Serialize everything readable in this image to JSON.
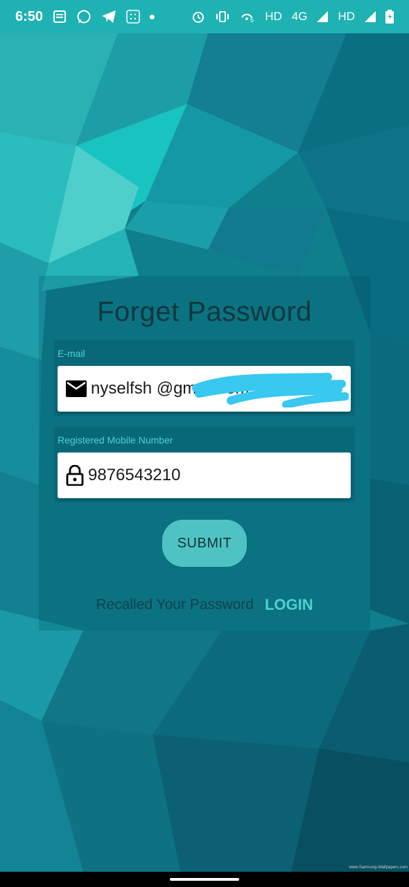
{
  "status_bar": {
    "time": "6:50",
    "network_text_1": "HD",
    "network_text_2": "4G",
    "network_text_3": "HD",
    "icons": [
      "news-icon",
      "whatsapp-icon",
      "telegram-icon",
      "grid-app-icon",
      "dot-icon",
      "alarm-icon",
      "vibrate-icon",
      "hotspot-icon",
      "signal-icon",
      "battery-icon"
    ]
  },
  "form": {
    "title": "Forget Password",
    "email_label": "E-mail",
    "email_value": "nyselfsh        @gmail.com",
    "mobile_label": "Registered Mobile Number",
    "mobile_value": "9876543210",
    "submit_label": "SUBMIT",
    "recall_text": "Recalled Your Password",
    "login_label": "LOGIN"
  },
  "watermark": "www.Samsung-Wallpapers.com",
  "colors": {
    "status_bar": "#1fb2b2",
    "accent": "#4fd0d0",
    "button": "#4fc3c3",
    "redaction": "#38c8f0"
  }
}
